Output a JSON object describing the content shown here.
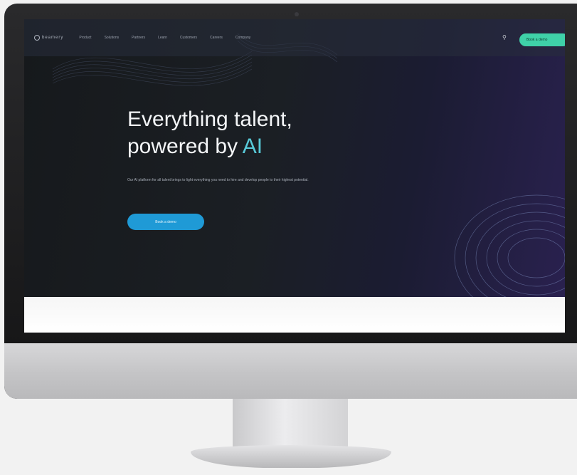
{
  "nav": {
    "logo": "beamery",
    "links": [
      "Product",
      "Solutions",
      "Partners",
      "Learn",
      "Customers",
      "Careers",
      "Company"
    ],
    "search_icon": "search-icon",
    "cta": "Book a demo"
  },
  "hero": {
    "title_line1": "Everything talent,",
    "title_line2_plain": "powered by ",
    "title_line2_accent": "AI",
    "subtitle": "Our AI platform for all talent brings to light everything you need to hire and develop people to their highest potential.",
    "button": "Book a demo"
  },
  "colors": {
    "accent": "#58c9d8",
    "cta_green": "#3fd1a8",
    "button_blue": "#1f9ad6",
    "background": "#16191c"
  }
}
